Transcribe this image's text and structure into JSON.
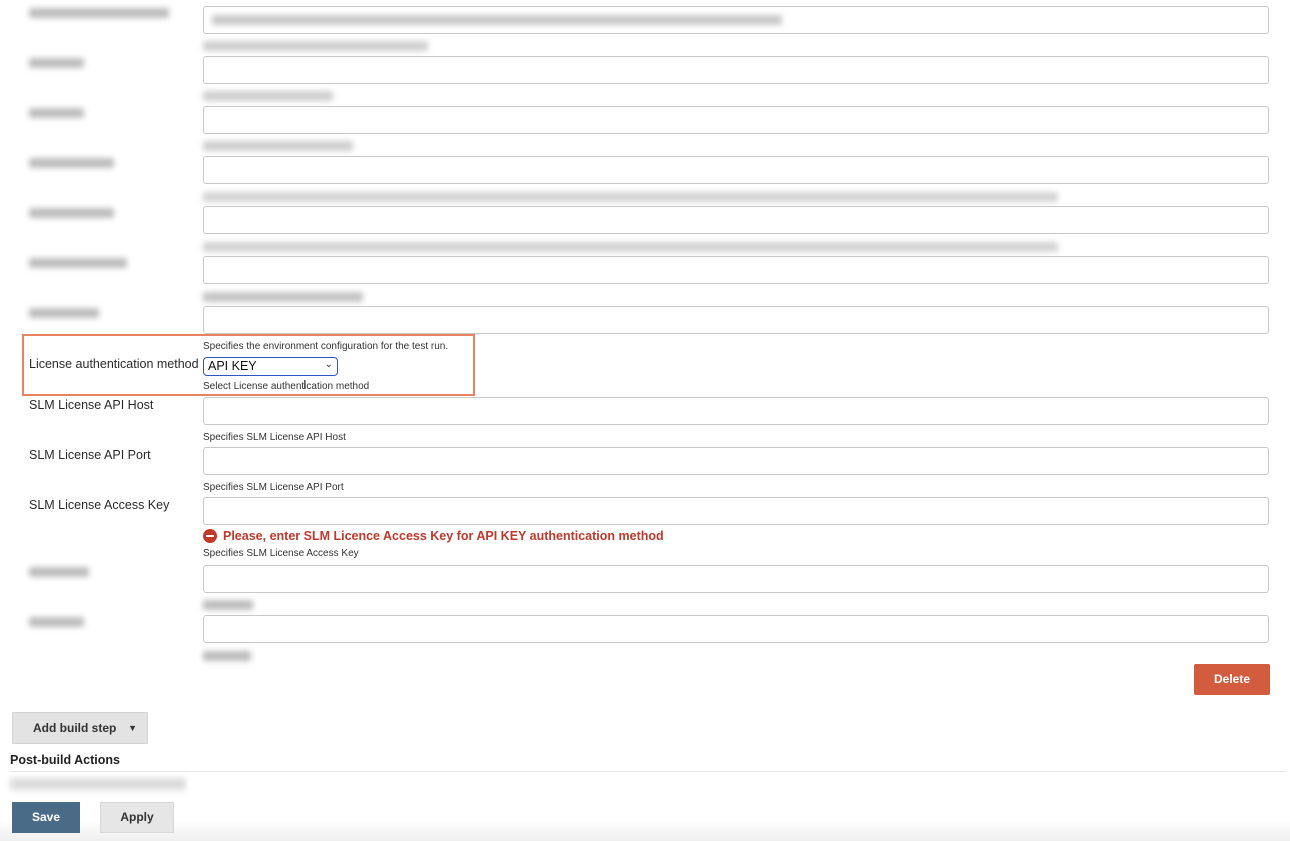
{
  "form": {
    "highlighted_row": {
      "help_above": "Specifies the environment configuration for the test run.",
      "label": "License authentication method",
      "select_value": "API KEY",
      "help_below": "Select License authentication method"
    },
    "slm_host": {
      "label": "SLM License API Host",
      "help": "Specifies SLM License API Host",
      "value": ""
    },
    "slm_port": {
      "label": "SLM License API Port",
      "help": "Specifies SLM License API Port",
      "value": ""
    },
    "slm_key": {
      "label": "SLM License Access Key",
      "error": "Please, enter SLM Licence Access Key for API KEY authentication method",
      "help": "Specifies SLM License Access Key",
      "value": ""
    }
  },
  "buttons": {
    "delete": "Delete",
    "add_build_step": "Add build step",
    "save": "Save",
    "apply": "Apply"
  },
  "sections": {
    "post_build": "Post-build Actions"
  },
  "icons": {
    "select_chevron": "chevron-down-icon",
    "error": "error-circle-icon",
    "dropdown_caret": "caret-down-icon"
  },
  "colors": {
    "highlight_border": "#e8835f",
    "error_text": "#c0392b",
    "delete_button": "#d35b3e",
    "save_button": "#4a6b88"
  }
}
